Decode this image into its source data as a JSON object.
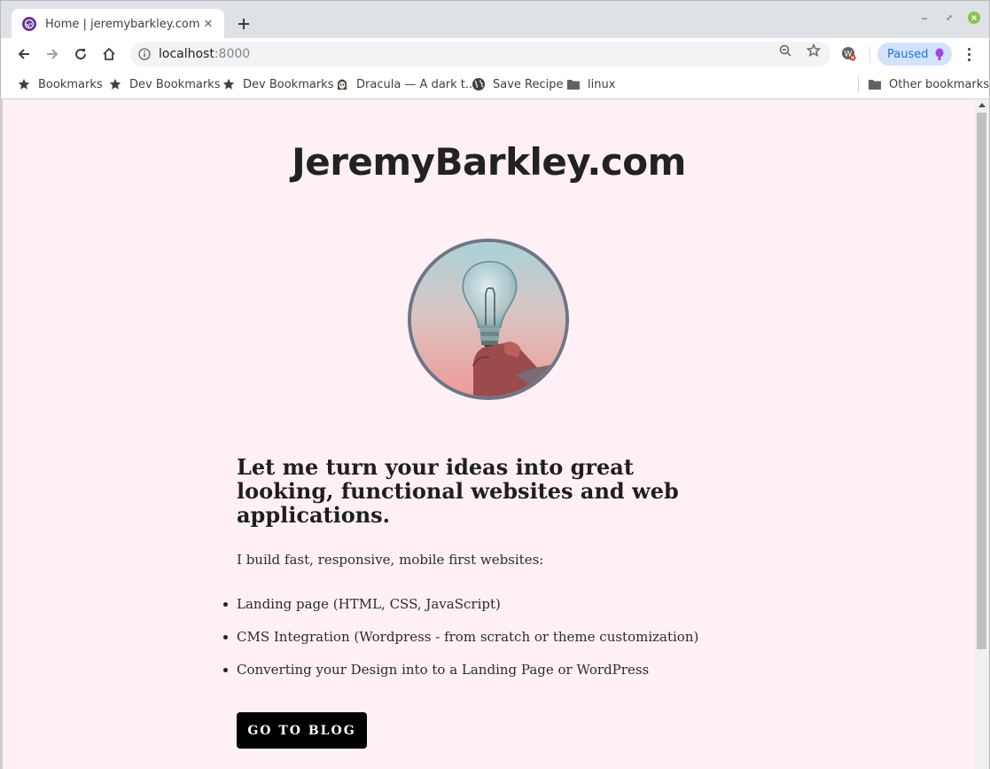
{
  "browser": {
    "tab": {
      "title": "Home | jeremybarkley.com"
    },
    "url": {
      "host": "localhost",
      "port": ":8000"
    },
    "profile": {
      "label": "Paused"
    },
    "bookmarks": [
      {
        "label": "Bookmarks",
        "icon": "star-icon"
      },
      {
        "label": "Dev Bookmarks",
        "icon": "star-icon"
      },
      {
        "label": "Dev Bookmarks",
        "icon": "star-icon"
      },
      {
        "label": "Dracula — A dark t...",
        "icon": "dracula-icon"
      },
      {
        "label": "Save Recipe",
        "icon": "globe-icon"
      },
      {
        "label": "linux",
        "icon": "folder-icon"
      }
    ],
    "other_bookmarks": {
      "label": "Other bookmarks",
      "icon": "folder-icon"
    }
  },
  "page": {
    "site_title": "JeremyBarkley.com",
    "hero_image": "lightbulb-in-hand",
    "headline": "Let me turn your ideas into great looking, functional websites and web applications.",
    "intro": "I build fast, responsive, mobile first websites:",
    "features": [
      "Landing page (HTML, CSS, JavaScript)",
      "CMS Integration (Wordpress - from scratch or theme customization)",
      "Converting your Design into to a Landing Page or WordPress"
    ],
    "cta_label": "GO TO BLOG"
  },
  "colors": {
    "page_background": "#fff0f5",
    "button_background": "#000000",
    "image_border": "#6f7586",
    "profile_chip": "#d2e3fc"
  }
}
